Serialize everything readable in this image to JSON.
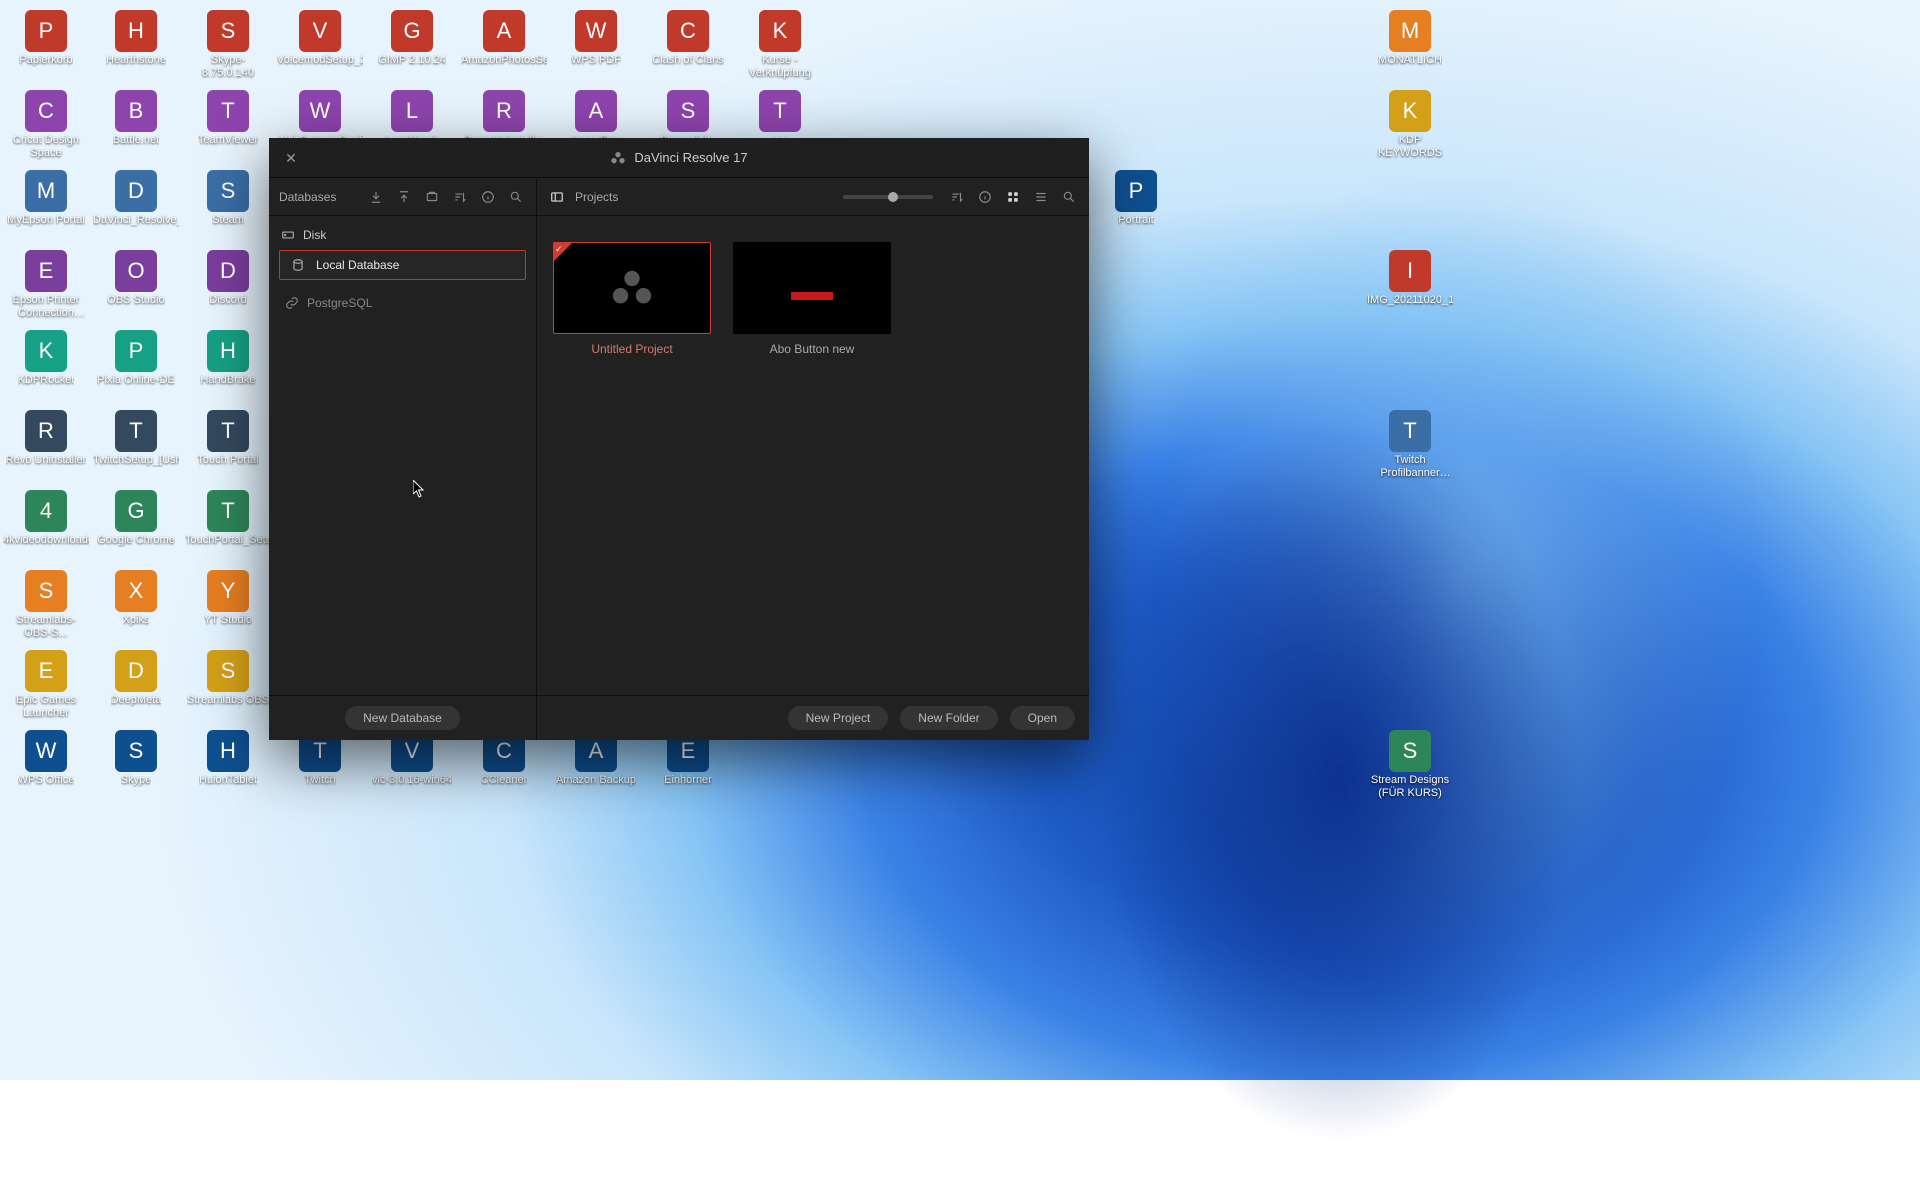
{
  "desktop": {
    "col1": [
      "Papierkorb",
      "Cricut Design Space",
      "MyEpson Portal",
      "Epson Printer Connection Checker",
      "KDPRocket",
      "Revo Uninstaller",
      "4kvideodownloader...",
      "Streamlabs-OBS-S...",
      "Epic Games Launcher",
      "WPS Office"
    ],
    "col2": [
      "Hearthstone",
      "Battle.net",
      "DaVinci_Resolve_16...",
      "OBS Studio",
      "Pixia Online-DE",
      "TwitchSetup_[Usher...",
      "Google Chrome",
      "Xpiks",
      "DeepMeta",
      "Skype"
    ],
    "col3": [
      "Skype-8.75.0.140",
      "TeamViewer",
      "Steam",
      "Discord",
      "HandBrake",
      "Touch Portal",
      "TouchPortal_Setup",
      "YT Studio",
      "Streamlabs OBS",
      "HuionTablet"
    ],
    "col4": [
      "VoicemodSetup_2.1...",
      "WebCameraConfig",
      "",
      "",
      "",
      "",
      "",
      "",
      "",
      "Twitch"
    ],
    "col5": [
      "GIMP 2.10.24",
      "LazyMerch",
      "",
      "",
      "",
      "",
      "",
      "",
      "",
      "vlc-3.0.16-win64"
    ],
    "col6": [
      "AmazonPhotosSetup",
      "Revo Uninstaller",
      "",
      "",
      "",
      "",
      "",
      "",
      "",
      "CCleaner"
    ],
    "col7": [
      "WPS PDF",
      "Avast Free Antivirus",
      "",
      "",
      "",
      "",
      "",
      "",
      "",
      "Amazon Backup"
    ],
    "col8": [
      "Clash of Clans",
      "Streamlabs Chatbot",
      "",
      "",
      "",
      "",
      "",
      "",
      "",
      "Einhörner"
    ],
    "col9": [
      "Kurse - Verknüpfung",
      "test",
      "",
      "",
      "",
      "",
      "",
      "",
      "",
      ""
    ],
    "colR1": [
      "MONATLICH",
      "KDP KEYWORDS",
      "",
      "IMG_20211020_114031",
      "",
      "Twitch Profilbanner template",
      "",
      "",
      "",
      "Stream Designs (FÜR KURS)"
    ],
    "colR2": [
      "",
      "",
      "Portrait",
      "",
      "",
      "",
      "",
      "",
      "",
      ""
    ]
  },
  "window": {
    "title": "DaVinci Resolve 17",
    "left": {
      "header": "Databases",
      "disk_label": "Disk",
      "local_db": "Local Database",
      "postgres_label": "PostgreSQL",
      "new_db_btn": "New Database"
    },
    "right": {
      "header": "Projects",
      "projects": [
        {
          "name": "Untitled Project",
          "selected": true
        },
        {
          "name": "Abo Button new",
          "selected": false
        }
      ],
      "new_project_btn": "New Project",
      "new_folder_btn": "New Folder",
      "open_btn": "Open"
    }
  }
}
